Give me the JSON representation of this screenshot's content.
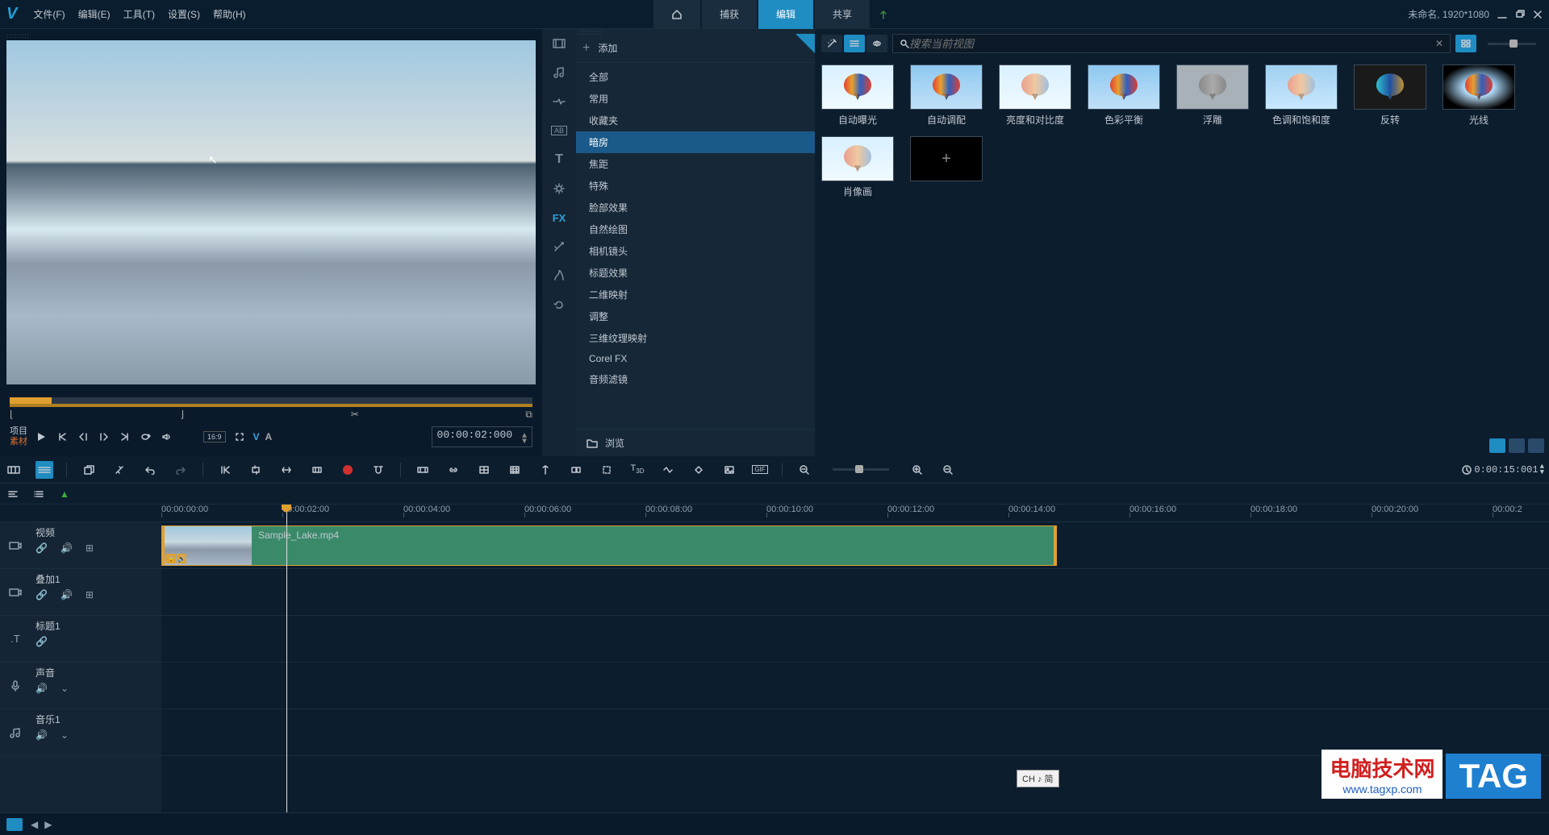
{
  "app": {
    "menu": {
      "file": "文件(F)",
      "edit": "编辑(E)",
      "tools": "工具(T)",
      "settings": "设置(S)",
      "help": "帮助(H)"
    },
    "tabs": {
      "capture": "捕获",
      "edit": "编辑",
      "share": "共享"
    },
    "project_info": "未命名, 1920*1080"
  },
  "preview": {
    "label_project": "项目",
    "label_material": "素材",
    "timecode": "00:00:02:000",
    "aspect": "16:9"
  },
  "library": {
    "add_label": "添加",
    "fx_label": "FX",
    "browse": "浏览",
    "categories": [
      "全部",
      "常用",
      "收藏夹",
      "暗房",
      "焦距",
      "特殊",
      "脸部效果",
      "自然绘图",
      "相机镜头",
      "标题效果",
      "二维映射",
      "调整",
      "三维纹理映射",
      "Corel FX",
      "音频滤镜"
    ],
    "selected_category": "暗房",
    "search_placeholder": "搜索当前视图",
    "effects": [
      "自动曝光",
      "自动调配",
      "亮度和对比度",
      "色彩平衡",
      "浮雕",
      "色调和饱和度",
      "反转",
      "光线",
      "肖像画"
    ]
  },
  "timeline": {
    "duration": "0:00:15:001",
    "ticks": [
      "00:00:00:00",
      "00:00:02:00",
      "00:00:04:00",
      "00:00:06:00",
      "00:00:08:00",
      "00:00:10:00",
      "00:00:12:00",
      "00:00:14:00",
      "00:00:16:00",
      "00:00:18:00",
      "00:00:20:00",
      "00:00:2"
    ],
    "tracks": [
      {
        "name": "视频",
        "icon": "video",
        "link": true,
        "vol": true,
        "extra": "grid"
      },
      {
        "name": "叠加1",
        "icon": "video",
        "link": true,
        "vol": true,
        "extra": "grid"
      },
      {
        "name": "标题1",
        "icon": "text",
        "link": true,
        "vol": false,
        "extra": null
      },
      {
        "name": "声音",
        "icon": "mic",
        "link": false,
        "vol": true,
        "extra": "chev"
      },
      {
        "name": "音乐1",
        "icon": "music",
        "link": false,
        "vol": true,
        "extra": "chev"
      }
    ],
    "clip_name": "Sample_Lake.mp4"
  },
  "watermark": {
    "title": "电脑技术网",
    "url": "www.tagxp.com",
    "tag": "TAG"
  },
  "ime": "CH ♪ 简"
}
